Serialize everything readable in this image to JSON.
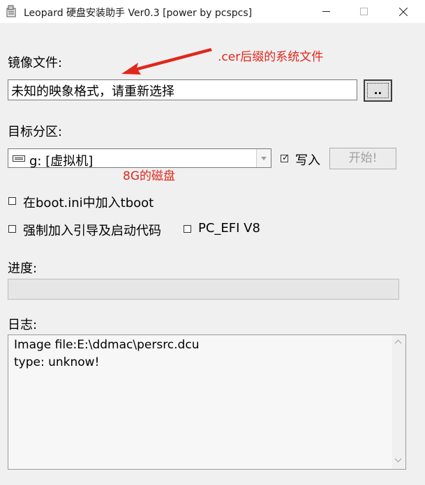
{
  "window": {
    "title": "Leopard 硬盘安装助手 Ver0.3 [power by pcspcs]"
  },
  "image_file": {
    "label": "镜像文件:",
    "value": "未知的映象格式，请重新选择",
    "browse_label": ".."
  },
  "target": {
    "label": "目标分区:",
    "selected": "g: [虚拟机]",
    "write_label": "写入",
    "write_checked": true,
    "start_label": "开始!"
  },
  "options": {
    "tboot_label": "在boot.ini中加入tboot",
    "tboot_checked": false,
    "force_label": "强制加入引导及启动代码",
    "force_checked": false,
    "pcefi_label": "PC_EFI V8",
    "pcefi_checked": false
  },
  "progress": {
    "label": "进度:",
    "value": 0
  },
  "log": {
    "label": "日志:",
    "lines": [
      "Image file:E:\\ddmac\\persrc.dcu",
      "type: unknow!"
    ]
  },
  "annotations": {
    "cer_note": ".cer后缀的系统文件",
    "disk_note": "8G的磁盘",
    "color": "#e1261c"
  },
  "icons": {
    "app": "leopard-app-icon",
    "drive": "drive-icon",
    "arrow": "red-arrow-annotation"
  }
}
